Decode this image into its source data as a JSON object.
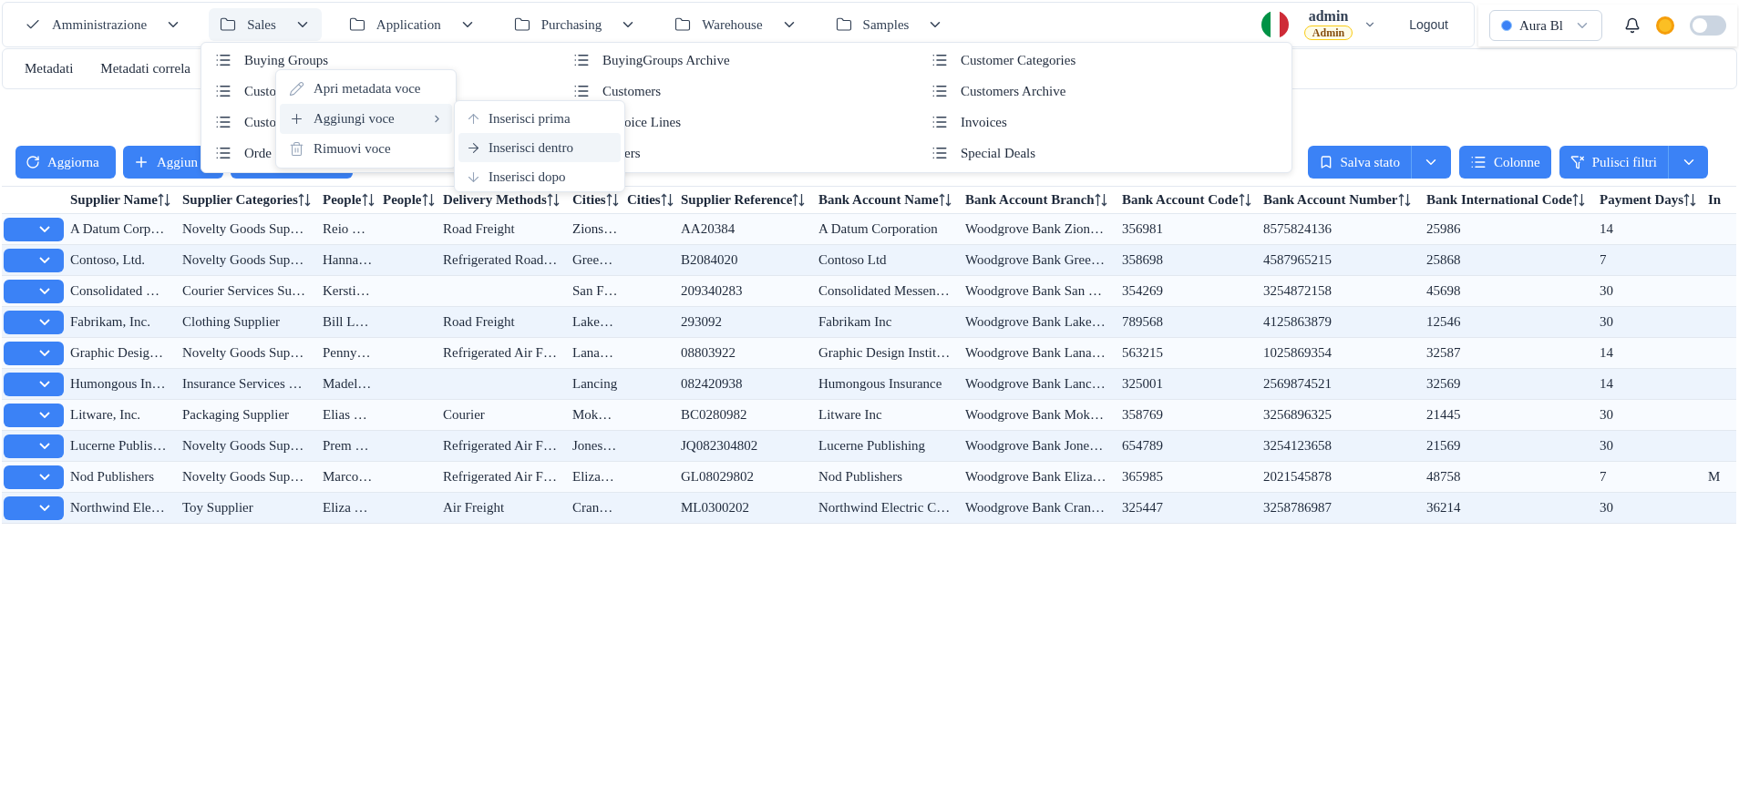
{
  "nav": {
    "items": [
      {
        "label": "Amministrazione",
        "kind": "check",
        "selected": false
      },
      {
        "label": "Sales",
        "kind": "folder",
        "selected": true
      },
      {
        "label": "Application",
        "kind": "folder",
        "selected": false
      },
      {
        "label": "Purchasing",
        "kind": "folder",
        "selected": false
      },
      {
        "label": "Warehouse",
        "kind": "folder",
        "selected": false
      },
      {
        "label": "Samples",
        "kind": "folder",
        "selected": false
      }
    ],
    "user": {
      "name": "admin",
      "role": "Admin"
    },
    "logout": "Logout",
    "theme": "Aura Bl",
    "dark_mode": {
      "on": false
    }
  },
  "subtabs": [
    "Metadati",
    "Metadati correla"
  ],
  "toolbar": {
    "left": [
      {
        "label": "Aggiorna",
        "kind": "refresh"
      },
      {
        "label": "Aggiun",
        "kind": "add"
      },
      {
        "kind": "blank"
      }
    ],
    "right": [
      {
        "label": "Salva stato",
        "kind": "bookmark",
        "split": true
      },
      {
        "label": "Colonne",
        "kind": "list",
        "split": false
      },
      {
        "label": "Pulisci filtri",
        "kind": "filter",
        "split": true
      }
    ]
  },
  "sales_menu": {
    "columns": [
      [
        {
          "label": "Buying Groups",
          "icon": true
        },
        {
          "label": "Custo",
          "icon": true
        },
        {
          "label": "Custo",
          "icon": true
        },
        {
          "label": "Orde",
          "icon": true
        }
      ],
      [
        {
          "label": "BuyingGroups Archive",
          "icon": true
        },
        {
          "label": "Customers",
          "icon": true
        },
        {
          "label": "oice Lines",
          "icon": false
        },
        {
          "label": "ers",
          "icon": false
        }
      ],
      [
        {
          "label": "Customer Categories",
          "icon": true
        },
        {
          "label": "Customers Archive",
          "icon": true
        },
        {
          "label": "Invoices",
          "icon": true
        },
        {
          "label": "Special Deals",
          "icon": true
        }
      ]
    ]
  },
  "context_menu": {
    "items": [
      {
        "label": "Apri metadata voce",
        "kind": "edit",
        "selected": false,
        "submenu": false
      },
      {
        "label": "Aggiungi voce",
        "kind": "add",
        "selected": true,
        "submenu": true
      },
      {
        "label": "Rimuovi voce",
        "kind": "delete",
        "selected": false,
        "submenu": false
      }
    ]
  },
  "submenu": {
    "items": [
      {
        "label": "Inserisci prima",
        "kind": "up",
        "selected": false
      },
      {
        "label": "Inserisci dentro",
        "kind": "right",
        "selected": true
      },
      {
        "label": "Inserisci dopo",
        "kind": "down",
        "selected": false
      }
    ]
  },
  "table": {
    "columns": [
      {
        "label": "Supplier Name",
        "sortable": true
      },
      {
        "label": "Supplier Categories",
        "sortable": true
      },
      {
        "label": "People",
        "sortable": true
      },
      {
        "label": "People",
        "sortable": true
      },
      {
        "label": "Delivery Methods",
        "sortable": true
      },
      {
        "label": "Cities",
        "sortable": true
      },
      {
        "label": "Cities",
        "sortable": true
      },
      {
        "label": "Supplier Reference",
        "sortable": true
      },
      {
        "label": "Bank Account Name",
        "sortable": true
      },
      {
        "label": "Bank Account Branch",
        "sortable": true
      },
      {
        "label": "Bank Account Code",
        "sortable": true
      },
      {
        "label": "Bank Account Number",
        "sortable": true
      },
      {
        "label": "Bank International Code",
        "sortable": true
      },
      {
        "label": "Payment Days",
        "sortable": true
      },
      {
        "label": "In",
        "sortable": false
      }
    ],
    "rows": [
      [
        "A Datum Corp…",
        "Novelty Goods Sup…",
        "Reio …",
        null,
        "Road Freight",
        "Zions…",
        null,
        "AA20384",
        "A Datum Corporation",
        "Woodgrove Bank Zion…",
        "356981",
        "8575824136",
        "25986",
        "14"
      ],
      [
        "Contoso, Ltd.",
        "Novelty Goods Sup…",
        "Hanna…",
        null,
        "Refrigerated Road…",
        "Gree…",
        null,
        "B2084020",
        "Contoso Ltd",
        "Woodgrove Bank Gree…",
        "358698",
        "4587965215",
        "25868",
        "7"
      ],
      [
        "Consolidated …",
        "Courier Services Su…",
        "Kersti…",
        null,
        null,
        "San F…",
        null,
        "209340283",
        "Consolidated Messen…",
        "Woodgrove Bank San …",
        "354269",
        "3254872158",
        "45698",
        "30"
      ],
      [
        "Fabrikam, Inc.",
        "Clothing Supplier",
        "Bill L…",
        null,
        "Road Freight",
        "Lake…",
        null,
        "293092",
        "Fabrikam Inc",
        "Woodgrove Bank Lake…",
        "789568",
        "4125863879",
        "12546",
        "30"
      ],
      [
        "Graphic Desig…",
        "Novelty Goods Sup…",
        "Penny…",
        null,
        "Refrigerated Air F…",
        "Lana…",
        null,
        "08803922",
        "Graphic Design Instit…",
        "Woodgrove Bank Lana…",
        "563215",
        "1025869354",
        "32587",
        "14"
      ],
      [
        "Humongous In…",
        "Insurance Services …",
        "Madel…",
        null,
        null,
        "Lancing",
        null,
        "082420938",
        "Humongous Insurance",
        "Woodgrove Bank Lanc…",
        "325001",
        "2569874521",
        "32569",
        "14"
      ],
      [
        "Litware, Inc.",
        "Packaging Supplier",
        "Elias …",
        null,
        "Courier",
        "Mok…",
        null,
        "BC0280982",
        "Litware Inc",
        "Woodgrove Bank Mok…",
        "358769",
        "3256896325",
        "21445",
        "30"
      ],
      [
        "Lucerne Publis…",
        "Novelty Goods Sup…",
        "Prem …",
        null,
        "Refrigerated Air F…",
        "Jones…",
        null,
        "JQ082304802",
        "Lucerne Publishing",
        "Woodgrove Bank Jone…",
        "654789",
        "3254123658",
        "21569",
        "30"
      ],
      [
        "Nod Publishers",
        "Novelty Goods Sup…",
        "Marco…",
        null,
        "Refrigerated Air F…",
        "Eliza…",
        null,
        "GL08029802",
        "Nod Publishers",
        "Woodgrove Bank Eliza…",
        "365985",
        "2021545878",
        "48758",
        "7",
        "M"
      ],
      [
        "Northwind Ele…",
        "Toy Supplier",
        "Eliza …",
        null,
        "Air Freight",
        "Cran…",
        null,
        "ML0300202",
        "Northwind Electric C…",
        "Woodgrove Bank Cran…",
        "325447",
        "3258786987",
        "36214",
        "30"
      ]
    ]
  }
}
